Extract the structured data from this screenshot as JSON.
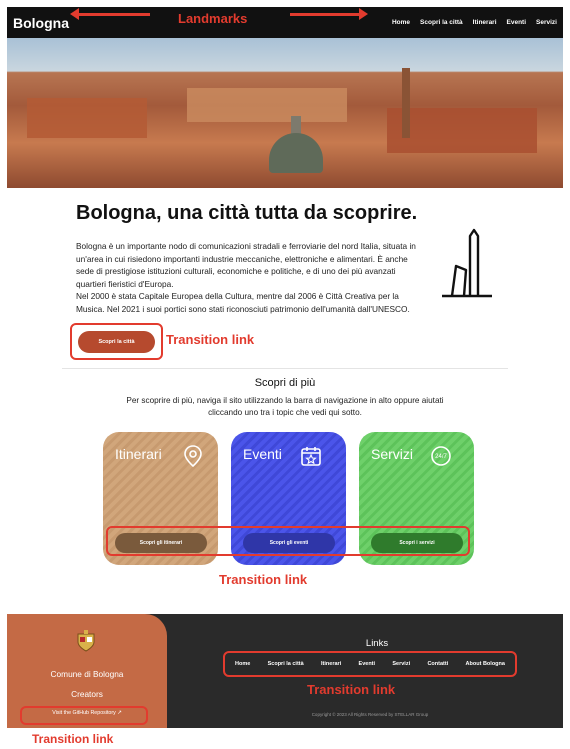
{
  "nav": {
    "brand": "Bologna",
    "annotation": "Landmarks",
    "links": [
      "Home",
      "Scopri la città",
      "Itinerari",
      "Eventi",
      "Servizi"
    ]
  },
  "main": {
    "title": "Bologna, una città tutta da scoprire.",
    "intro_p1": "Bologna è un importante nodo di comunicazioni stradali e ferroviarie del nord Italia, situata in un'area in cui risiedono importanti industrie meccaniche, elettroniche e alimentari. È anche sede di prestigiose istituzioni culturali, economiche e politiche, e di uno dei più avanzati quartieri fieristici d'Europa.",
    "intro_p2": "Nel 2000 è stata Capitale Europea della Cultura, mentre dal 2006 è Città Creativa per la Musica. Nel 2021 i suoi portici sono stati riconosciuti patrimonio dell'umanità dall'UNESCO.",
    "discover_button": "Scopri la città",
    "annotation_transition": "Transition link"
  },
  "scopri": {
    "title": "Scopri di più",
    "subtitle": "Per scoprire di più, naviga il sito utilizzando la barra di navigazione in alto oppure aiutati cliccando uno tra i topic che vedi qui sotto.",
    "cards": [
      {
        "title": "Itinerari",
        "button": "Scopri gli itinerari",
        "icon": "location-pin-icon"
      },
      {
        "title": "Eventi",
        "button": "Scopri gli eventi",
        "icon": "calendar-star-icon"
      },
      {
        "title": "Servizi",
        "button": "Scopri i servizi",
        "icon": "24-7-icon",
        "badge": "24/7"
      }
    ],
    "annotation_transition": "Transition link"
  },
  "footer": {
    "org_name": "Comune di Bologna",
    "creators": "Creators",
    "github_link": "Visit the GitHub Repository ↗",
    "links_title": "Links",
    "links": [
      "Home",
      "Scopri la città",
      "Itinerari",
      "Eventi",
      "Servizi",
      "Contatti",
      "About Bologna"
    ],
    "copyright": "Copyright © 2023 All Rights Reserved by STELLAR Group",
    "annotation_footer": "Transition link",
    "annotation_bottom": "Transition link"
  },
  "colors": {
    "annotation": "#e23b2e",
    "primary_button": "#b64a2e",
    "card_itinerari": "#d1a67b",
    "card_eventi": "#4b55ea",
    "card_servizi": "#6ed06a",
    "footer_bg": "#2a2a2a",
    "footer_left_bg": "#c46a45"
  }
}
